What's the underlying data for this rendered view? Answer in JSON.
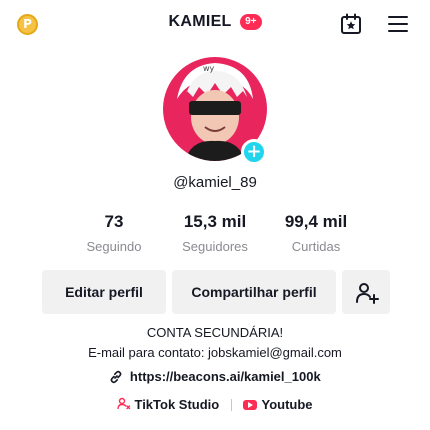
{
  "topbar": {
    "coin_glyph": "P",
    "username": "KAMIEL",
    "notif_badge": "9+",
    "icons": [
      "coin-icon",
      "bookmark-star-icon",
      "menu-icon"
    ]
  },
  "profile": {
    "handle": "@kamiel_89",
    "avatar_colors": {
      "ring": "#e8255c",
      "badge": "#20d5ec"
    }
  },
  "stats": [
    {
      "value": "73",
      "label": "Seguindo"
    },
    {
      "value": "15,3 mil",
      "label": "Seguidores"
    },
    {
      "value": "99,4 mil",
      "label": "Curtidas"
    }
  ],
  "actions": {
    "edit_label": "Editar perfil",
    "share_label": "Compartilhar perfil"
  },
  "bio": {
    "line1": "CONTA SECUNDÁRIA!",
    "line2": "E-mail para contato: jobskamiel@gmail.com"
  },
  "link": {
    "url_text": "https://beacons.ai/kamiel_100k"
  },
  "apps": {
    "studio_label": "TikTok Studio",
    "youtube_label": "Youtube"
  },
  "colors": {
    "accent": "#fe2c55",
    "text": "#161823",
    "muted": "#8a8b91",
    "button_bg": "#f1f1f2"
  }
}
